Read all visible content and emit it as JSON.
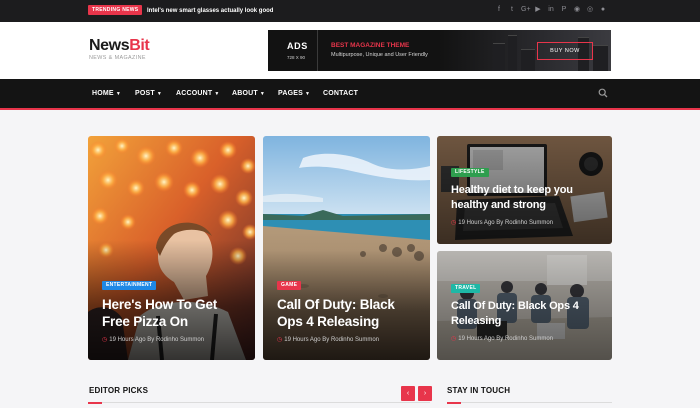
{
  "topbar": {
    "trending_label": "TRENDING NEWS",
    "trending_text": "Intel's new smart glasses actually look good",
    "social": [
      {
        "icon": "facebook-icon",
        "glyph": "f"
      },
      {
        "icon": "twitter-icon",
        "glyph": "t"
      },
      {
        "icon": "google-plus-icon",
        "glyph": "G+"
      },
      {
        "icon": "youtube-icon",
        "glyph": "▶"
      },
      {
        "icon": "linkedin-icon",
        "glyph": "in"
      },
      {
        "icon": "pinterest-icon",
        "glyph": "P"
      },
      {
        "icon": "rss-icon",
        "glyph": "◉"
      },
      {
        "icon": "github-icon",
        "glyph": "◎"
      },
      {
        "icon": "reddit-icon",
        "glyph": "●"
      }
    ]
  },
  "header": {
    "logo_main": "News",
    "logo_accent": "Bit",
    "logo_sub": "NEWS & MAGAZINE"
  },
  "ad": {
    "label": "ADS",
    "size": "728 X 90",
    "title": "BEST MAGAZINE THEME",
    "subtitle": "Multipurpose, Unique and User Friendly",
    "button": "BUY NOW"
  },
  "nav": {
    "items": [
      "HOME",
      "POST",
      "ACCOUNT",
      "ABOUT",
      "PAGES",
      "CONTACT"
    ],
    "has_caret": [
      true,
      true,
      true,
      true,
      true,
      false
    ]
  },
  "cards": [
    {
      "category": "ENTERTAINMENT",
      "category_color": "#1e88e5",
      "title": "Here's How To Get Free Pizza On",
      "time": "19 Hours Ago",
      "by": "By",
      "author": "Rodinho Summon"
    },
    {
      "category": "GAME",
      "category_color": "#e8354b",
      "title": "Call Of Duty: Black Ops 4 Releasing",
      "time": "19 Hours Ago",
      "by": "By",
      "author": "Rodinho Summon"
    },
    {
      "category": "LIFESTYLE",
      "category_color": "#2e9e4e",
      "title": "Healthy diet to keep you healthy and strong",
      "time": "19 Hours Ago",
      "by": "By",
      "author": "Rodinho Summon"
    },
    {
      "category": "TRAVEL",
      "category_color": "#1eb8a6",
      "title": "Call Of Duty: Black Ops 4 Releasing",
      "time": "19 Hours Ago",
      "by": "By",
      "author": "Rodinho Summon"
    }
  ],
  "sections": {
    "editor_picks": "EDITOR PICKS",
    "stay_in_touch": "STAY IN TOUCH",
    "prev": "‹",
    "next": "›"
  },
  "colors": {
    "accent": "#e8354b",
    "dark": "#141414"
  }
}
